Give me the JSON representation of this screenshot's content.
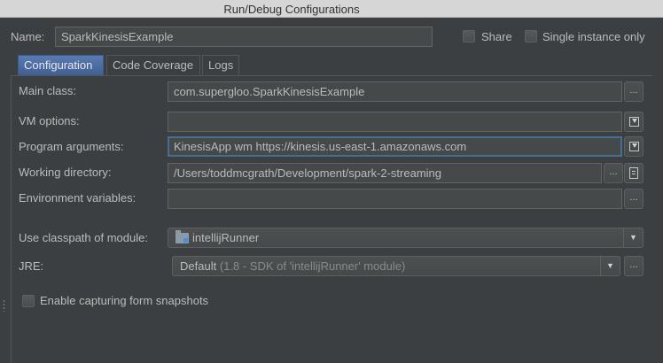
{
  "window": {
    "title": "Run/Debug Configurations"
  },
  "header": {
    "name_label": "Name:",
    "name_value": "SparkKinesisExample",
    "share_label": "Share",
    "single_instance_label": "Single instance only"
  },
  "tabs": [
    {
      "label": "Configuration",
      "active": true
    },
    {
      "label": "Code Coverage",
      "active": false
    },
    {
      "label": "Logs",
      "active": false
    }
  ],
  "form": {
    "main_class": {
      "label": "Main class:",
      "value": "com.supergloo.SparkKinesisExample",
      "button": "..."
    },
    "vm_options": {
      "label": "VM options:",
      "value": ""
    },
    "program_arguments": {
      "label": "Program arguments:",
      "value": "KinesisApp wm https://kinesis.us-east-1.amazonaws.com"
    },
    "working_directory": {
      "label": "Working directory:",
      "value": "/Users/toddmcgrath/Development/spark-2-streaming",
      "button": "..."
    },
    "environment_variables": {
      "label": "Environment variables:",
      "value": "",
      "button": "..."
    },
    "classpath_module": {
      "label": "Use classpath of module:",
      "value": "intellijRunner"
    },
    "jre": {
      "label": "JRE:",
      "value": "Default",
      "detail": "(1.8 - SDK of 'intellijRunner' module)",
      "button": "..."
    },
    "snapshots": {
      "label": "Enable capturing form snapshots",
      "checked": false
    }
  },
  "icons": {
    "insert_macro": "insert-macro-icon",
    "file_browse": "file-browse-icon",
    "module_folder": "module-folder-icon",
    "dropdown": "chevron-down-icon"
  },
  "colors": {
    "background": "#3c3f41",
    "field": "#45494a",
    "active_tab": "#4b6eaf",
    "focus_border": "#466d94",
    "text": "#bbbbbb"
  }
}
